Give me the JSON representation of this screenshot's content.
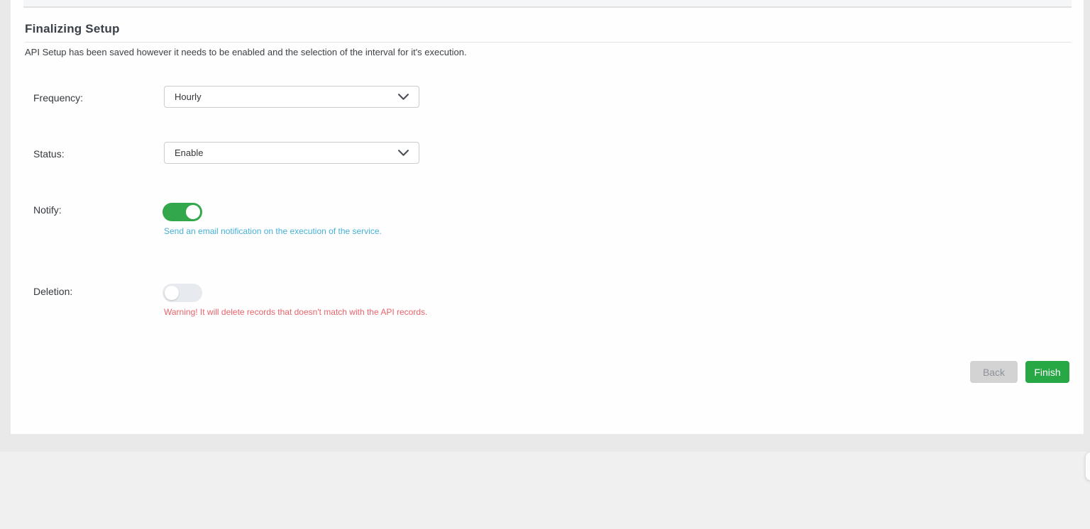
{
  "page": {
    "title": "Finalizing Setup",
    "description": "API Setup has been saved however it needs to be enabled and the selection of the interval for it's execution."
  },
  "form": {
    "frequency": {
      "label": "Frequency:",
      "value": "Hourly"
    },
    "status": {
      "label": "Status:",
      "value": "Enable"
    },
    "notify": {
      "label": "Notify:",
      "state": "on",
      "help": "Send an email notification on the execution of the service."
    },
    "deletion": {
      "label": "Deletion:",
      "state": "off",
      "warning": "Warning! It will delete records that doesn't match with the API records."
    }
  },
  "actions": {
    "back": "Back",
    "finish": "Finish"
  },
  "colors": {
    "toggle_on": "#32a74c",
    "toggle_off": "#e7eaee",
    "finish_button": "#28a745",
    "info_text": "#46b1d7",
    "warning_text": "#e8646b"
  }
}
